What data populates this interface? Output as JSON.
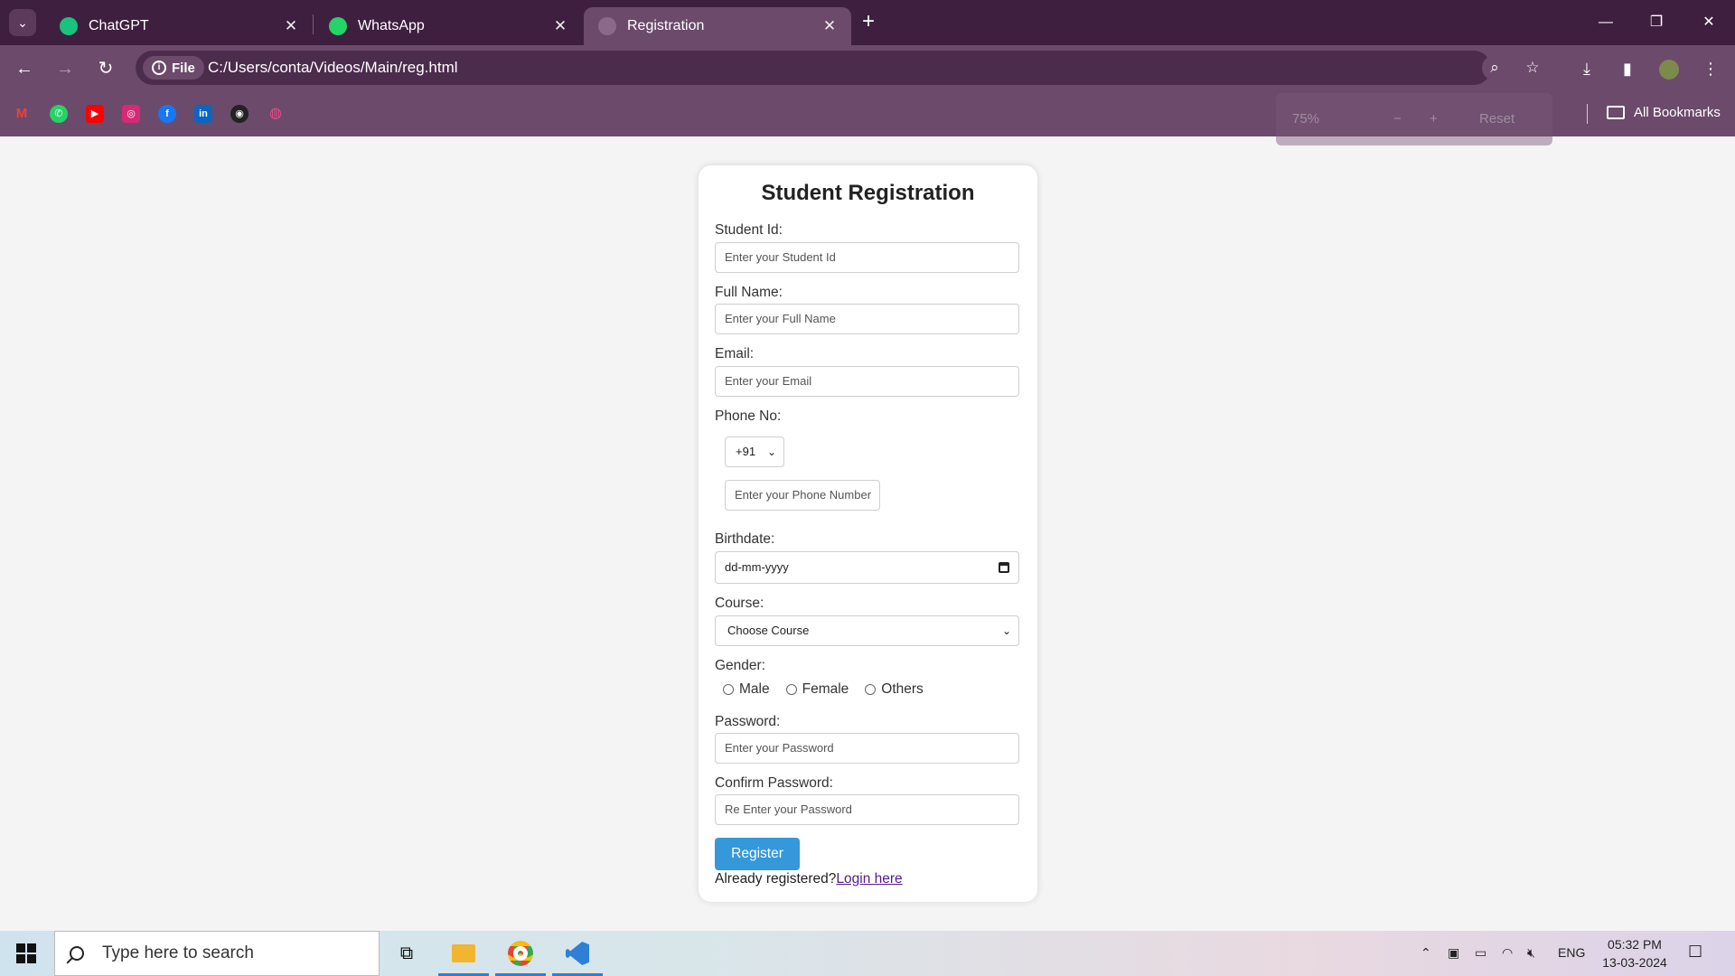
{
  "browser": {
    "tabs": [
      {
        "title": "ChatGPT",
        "favicon": "chatgpt-icon",
        "active": false
      },
      {
        "title": "WhatsApp",
        "favicon": "whatsapp-icon",
        "active": false
      },
      {
        "title": "Registration",
        "favicon": "globe-icon",
        "active": true
      }
    ],
    "address": {
      "scheme_label": "File",
      "url": "C:/Users/conta/Videos/Main/reg.html"
    },
    "zoom_popup": {
      "value": "75%",
      "minus": "−",
      "plus": "+",
      "reset": "Reset"
    },
    "bookmarks_label": "All Bookmarks",
    "bookmark_icons": [
      "gmail-icon",
      "whatsapp-icon",
      "youtube-icon",
      "instagram-icon",
      "facebook-icon",
      "linkedin-icon",
      "github-icon",
      "dribbble-icon"
    ],
    "colors": {
      "tabbar": "#3f1f3f",
      "toolbar": "#6c4a6c"
    }
  },
  "form": {
    "title": "Student Registration",
    "student_id": {
      "label": "Student Id:",
      "placeholder": "Enter your Student Id"
    },
    "full_name": {
      "label": "Full Name:",
      "placeholder": "Enter your Full Name"
    },
    "email": {
      "label": "Email:",
      "placeholder": "Enter your Email"
    },
    "phone": {
      "label": "Phone No:",
      "country_code": "+91",
      "placeholder": "Enter your Phone Number"
    },
    "birthdate": {
      "label": "Birthdate:",
      "placeholder": "dd-mm-yyyy"
    },
    "course": {
      "label": "Course:",
      "selected": "Choose Course"
    },
    "gender": {
      "label": "Gender:",
      "options": [
        "Male",
        "Female",
        "Others"
      ]
    },
    "password": {
      "label": "Password:",
      "placeholder": "Enter your Password"
    },
    "confirm_password": {
      "label": "Confirm Password:",
      "placeholder": "Re Enter your Password"
    },
    "register_label": "Register",
    "already_text": "Already registered?",
    "login_link": "Login here",
    "accent": "#3498db"
  },
  "taskbar": {
    "search_placeholder": "Type here to search",
    "language": "ENG",
    "time": "05:32 PM",
    "date": "13-03-2024"
  }
}
